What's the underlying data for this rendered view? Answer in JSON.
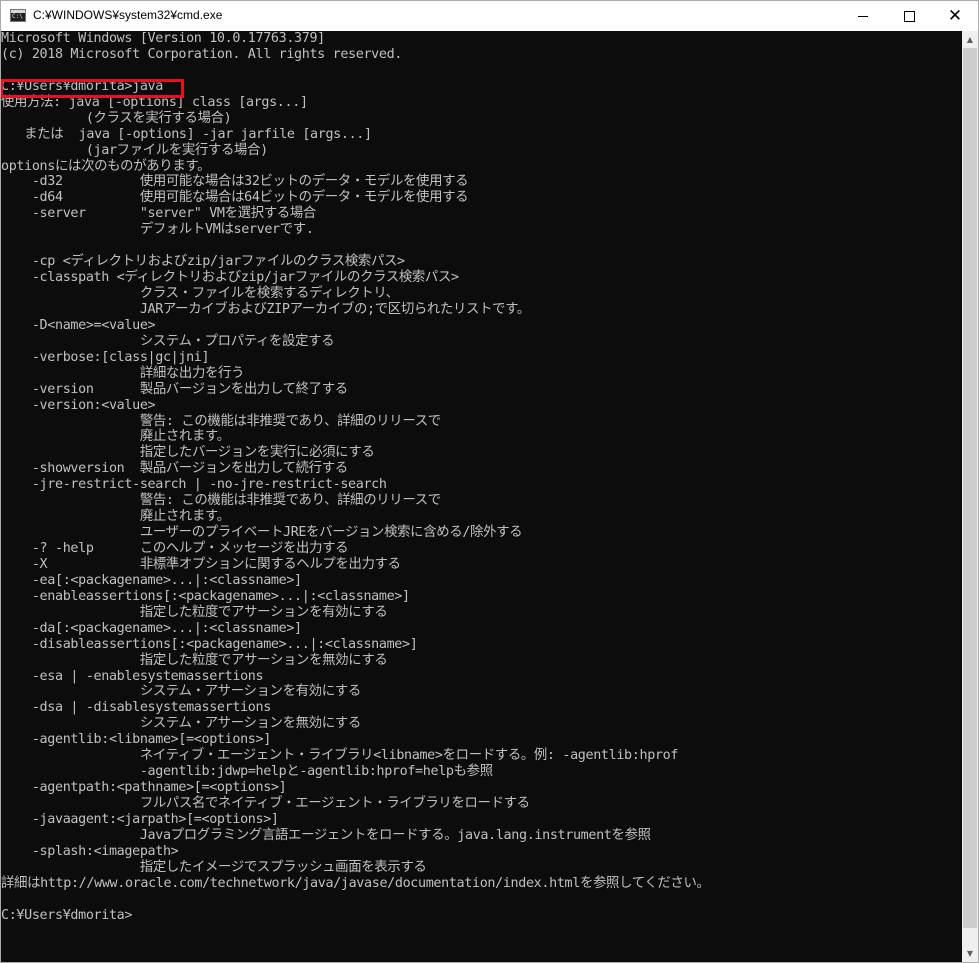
{
  "window": {
    "title": "C:¥WINDOWS¥system32¥cmd.exe",
    "icon": "cmd-icon",
    "controls": {
      "minimize_icon": "minimize-icon",
      "maximize_icon": "maximize-icon",
      "close_icon": "close-icon",
      "close_glyph": "✕"
    }
  },
  "colors": {
    "console_background": "#0c0c0c",
    "console_text": "#c0c0c0",
    "highlight_border": "#e81123"
  },
  "console": {
    "lines": [
      "Microsoft Windows [Version 10.0.17763.379]",
      "(c) 2018 Microsoft Corporation. All rights reserved.",
      "",
      "C:¥Users¥dmorita>java",
      "使用方法: java [-options] class [args...]",
      "           (クラスを実行する場合)",
      "   または  java [-options] -jar jarfile [args...]",
      "           (jarファイルを実行する場合)",
      "optionsには次のものがあります。",
      "    -d32          使用可能な場合は32ビットのデータ・モデルを使用する",
      "    -d64          使用可能な場合は64ビットのデータ・モデルを使用する",
      "    -server       \"server\" VMを選択する場合",
      "                  デフォルトVMはserverです.",
      "",
      "    -cp <ディレクトリおよびzip/jarファイルのクラス検索パス>",
      "    -classpath <ディレクトリおよびzip/jarファイルのクラス検索パス>",
      "                  クラス・ファイルを検索するディレクトリ、",
      "                  JARアーカイブおよびZIPアーカイブの;で区切られたリストです。",
      "    -D<name>=<value>",
      "                  システム・プロパティを設定する",
      "    -verbose:[class|gc|jni]",
      "                  詳細な出力を行う",
      "    -version      製品バージョンを出力して終了する",
      "    -version:<value>",
      "                  警告: この機能は非推奨であり、詳細のリリースで",
      "                  廃止されます。",
      "                  指定したバージョンを実行に必須にする",
      "    -showversion  製品バージョンを出力して続行する",
      "    -jre-restrict-search | -no-jre-restrict-search",
      "                  警告: この機能は非推奨であり、詳細のリリースで",
      "                  廃止されます。",
      "                  ユーザーのプライベートJREをバージョン検索に含める/除外する",
      "    -? -help      このヘルプ・メッセージを出力する",
      "    -X            非標準オプションに関するヘルプを出力する",
      "    -ea[:<packagename>...|:<classname>]",
      "    -enableassertions[:<packagename>...|:<classname>]",
      "                  指定した粒度でアサーションを有効にする",
      "    -da[:<packagename>...|:<classname>]",
      "    -disableassertions[:<packagename>...|:<classname>]",
      "                  指定した粒度でアサーションを無効にする",
      "    -esa | -enablesystemassertions",
      "                  システム・アサーションを有効にする",
      "    -dsa | -disablesystemassertions",
      "                  システム・アサーションを無効にする",
      "    -agentlib:<libname>[=<options>]",
      "                  ネイティブ・エージェント・ライブラリ<libname>をロードする。例: -agentlib:hprof",
      "                  -agentlib:jdwp=helpと-agentlib:hprof=helpも参照",
      "    -agentpath:<pathname>[=<options>]",
      "                  フルパス名でネイティブ・エージェント・ライブラリをロードする",
      "    -javaagent:<jarpath>[=<options>]",
      "                  Javaプログラミング言語エージェントをロードする。java.lang.instrumentを参照",
      "    -splash:<imagepath>",
      "                  指定したイメージでスプラッシュ画面を表示する",
      "詳細はhttp://www.oracle.com/technetwork/java/javase/documentation/index.htmlを参照してください。",
      "",
      "C:¥Users¥dmorita>"
    ]
  },
  "scrollbar": {
    "up_arrow": "▲",
    "down_arrow": "▼",
    "up_icon": "scroll-up-arrow-icon",
    "down_icon": "scroll-down-arrow-icon"
  }
}
